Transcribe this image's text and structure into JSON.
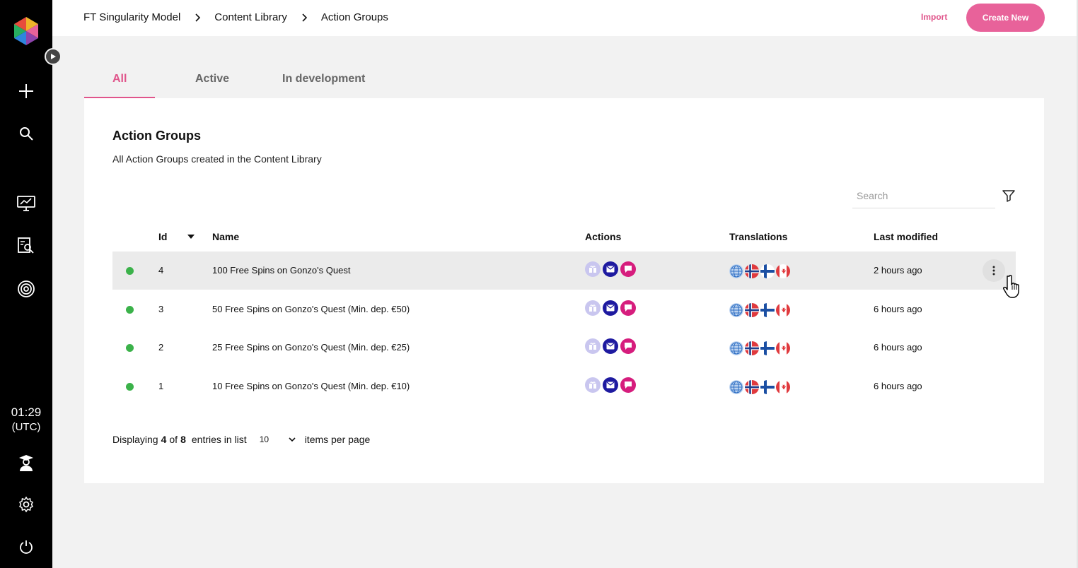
{
  "breadcrumb": [
    "FT Singularity Model",
    "Content Library",
    "Action Groups"
  ],
  "header": {
    "import_label": "Import",
    "create_label": "Create New"
  },
  "tabs": [
    {
      "label": "All",
      "active": true
    },
    {
      "label": "Active",
      "active": false
    },
    {
      "label": "In development",
      "active": false
    }
  ],
  "card": {
    "title": "Action Groups",
    "subtitle": "All Action Groups created in the Content Library"
  },
  "search": {
    "placeholder": "Search"
  },
  "table": {
    "columns": [
      "Id",
      "Name",
      "Actions",
      "Translations",
      "Last modified"
    ],
    "rows": [
      {
        "id": "4",
        "name": "100 Free Spins on Gonzo's Quest",
        "modified": "2 hours ago",
        "status": "active",
        "actions": [
          "gift-icon",
          "email-icon",
          "sms-icon"
        ],
        "translations": [
          "globe",
          "norway",
          "finland",
          "canada"
        ]
      },
      {
        "id": "3",
        "name": "50 Free Spins on Gonzo's Quest (Min. dep. €50)",
        "modified": "6 hours ago",
        "status": "active",
        "actions": [
          "gift-icon",
          "email-icon",
          "sms-icon"
        ],
        "translations": [
          "globe",
          "norway",
          "finland",
          "canada"
        ]
      },
      {
        "id": "2",
        "name": "25 Free Spins on Gonzo's Quest (Min. dep. €25)",
        "modified": "6 hours ago",
        "status": "active",
        "actions": [
          "gift-icon",
          "email-icon",
          "sms-icon"
        ],
        "translations": [
          "globe",
          "norway",
          "finland",
          "canada"
        ]
      },
      {
        "id": "1",
        "name": "10 Free Spins on Gonzo's Quest (Min. dep. €10)",
        "modified": "6 hours ago",
        "status": "active",
        "actions": [
          "gift-icon",
          "email-icon",
          "sms-icon"
        ],
        "translations": [
          "globe",
          "norway",
          "finland",
          "canada"
        ]
      }
    ]
  },
  "pagination": {
    "prefix": "Displaying",
    "shown": "4",
    "of": "of",
    "total": "8",
    "entries_text": "entries in list",
    "per_page_value": "10",
    "suffix": "items per page"
  },
  "clock": {
    "time": "01:29",
    "zone": "(UTC)"
  },
  "colors": {
    "accent": "#e0558b",
    "status_active": "#3bb24a",
    "email": "#1e1aa0",
    "sms": "#d61d7d",
    "gift": "#c9c6ef"
  }
}
